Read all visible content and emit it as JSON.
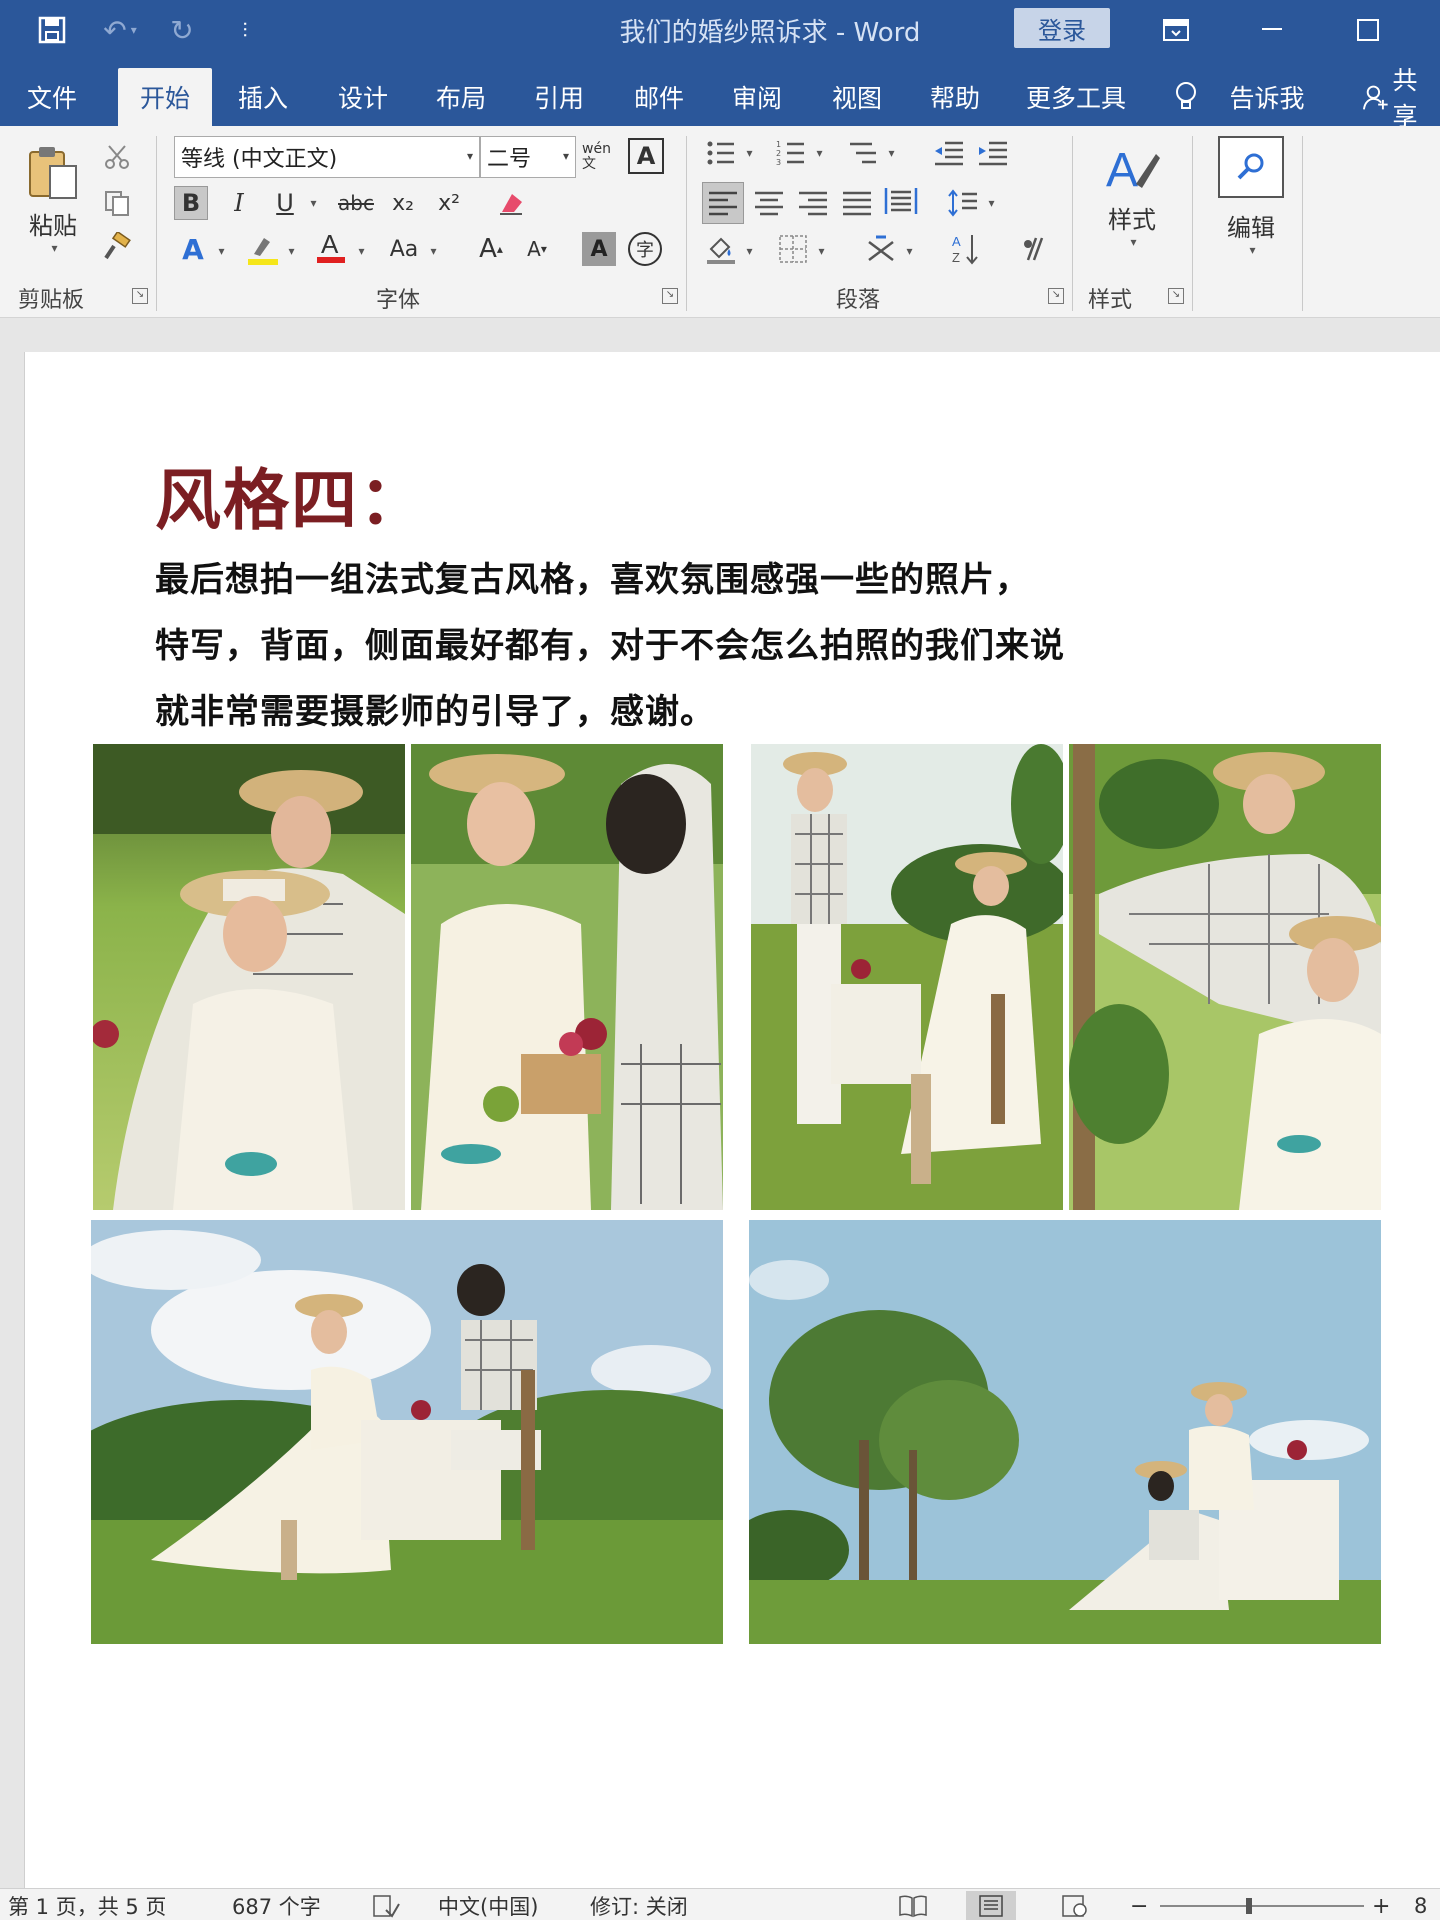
{
  "titlebar": {
    "doc_title": "我们的婚纱照诉求  -  Word",
    "login_label": "登录",
    "customize_glyph": "⫶"
  },
  "tabs": [
    {
      "label": "文件"
    },
    {
      "label": "开始"
    },
    {
      "label": "插入"
    },
    {
      "label": "设计"
    },
    {
      "label": "布局"
    },
    {
      "label": "引用"
    },
    {
      "label": "邮件"
    },
    {
      "label": "审阅"
    },
    {
      "label": "视图"
    },
    {
      "label": "帮助"
    },
    {
      "label": "更多工具"
    },
    {
      "label": "告诉我"
    },
    {
      "label": "共享"
    }
  ],
  "ribbon": {
    "clipboard": {
      "paste_label": "粘贴",
      "group_label": "剪贴板"
    },
    "font": {
      "font_name": "等线 (中文正文)",
      "font_size": "二号",
      "phonetic_label": "wén文",
      "border_char": "A",
      "bold": "B",
      "italic": "I",
      "underline": "U",
      "strike": "abc",
      "subscript": "x₂",
      "superscript": "x²",
      "change_case": "Aa",
      "grow": "A",
      "shrink": "A",
      "shading_char": "A",
      "enclose_char": "字",
      "group_label": "字体"
    },
    "paragraph": {
      "group_label": "段落"
    },
    "styles": {
      "button_label": "样式",
      "group_label": "样式"
    },
    "editing": {
      "button_label": "编辑"
    }
  },
  "document": {
    "heading": "风格四：",
    "paragraph_lines": [
      "最后想拍一组法式复古风格，喜欢氛围感强一些的照片，",
      "特写，背面，侧面最好都有，对于不会怎么拍照的我们来说",
      "就非常需要摄影师的引导了，感谢。"
    ]
  },
  "statusbar": {
    "page": "第 1 页，共 5 页",
    "words": "687 个字",
    "language": "中文(中国)",
    "track_changes": "修订: 关闭",
    "zoom": "8"
  },
  "colors": {
    "word_blue": "#2b579a",
    "heading_red": "#7b1e22",
    "ribbon_bg": "#f3f3f3"
  }
}
